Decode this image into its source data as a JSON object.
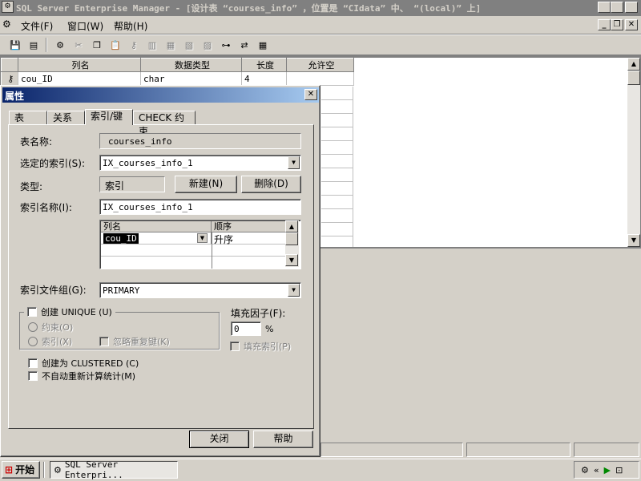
{
  "app": {
    "title": "SQL Server Enterprise Manager - [设计表 “courses_info” ，位置是 “CIdata” 中、 “(local)” 上]",
    "menu": [
      "文件(F)",
      "窗口(W)",
      "帮助(H)"
    ]
  },
  "table_design": {
    "columns": [
      "列名",
      "数据类型",
      "长度",
      "允许空"
    ],
    "rows": [
      {
        "name": "cou_ID",
        "type": "char",
        "length": "4",
        "nullable": ""
      }
    ]
  },
  "dialog": {
    "title": "属性",
    "tabs": [
      "表",
      "关系",
      "索引/键",
      "CHECK 约束"
    ],
    "active_tab": 2,
    "table_name_label": "表名称:",
    "table_name_value": "courses_info",
    "selected_index_label": "选定的索引(S):",
    "selected_index_value": "IX_courses_info_1",
    "type_label": "类型:",
    "type_value": "索引",
    "new_button": "新建(N)",
    "delete_button": "删除(D)",
    "index_name_label": "索引名称(I):",
    "index_name_value": "IX_courses_info_1",
    "index_grid": {
      "headers": [
        "列名",
        "顺序"
      ],
      "rows": [
        {
          "column": "cou_ID",
          "order": "升序"
        }
      ]
    },
    "filegroup_label": "索引文件组(G):",
    "filegroup_value": "PRIMARY",
    "create_unique_label": "创建 UNIQUE (U)",
    "constraint_label": "约束(O)",
    "index_radio_label": "索引(X)",
    "ignore_dup_label": "忽略重复键(K)",
    "fill_factor_label": "填充因子(F):",
    "fill_factor_value": "0",
    "fill_factor_unit": "%",
    "pad_index_label": "填充索引(P)",
    "clustered_label": "创建为 CLUSTERED (C)",
    "no_recompute_label": "不自动重新计算统计(M)",
    "close_button": "关闭",
    "help_button": "帮助"
  },
  "taskbar": {
    "start_label": "开始",
    "task_label": "SQL Server Enterpri..."
  }
}
